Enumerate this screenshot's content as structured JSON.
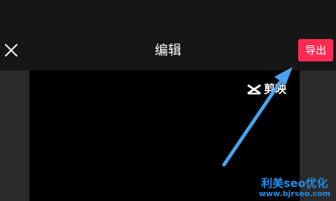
{
  "topbar": {
    "title": "编辑",
    "export_label": "导出"
  },
  "preview": {
    "watermark_text": "剪映"
  },
  "overlay": {
    "seo_watermark_line1": "利美seo优化",
    "seo_watermark_line2": "www.bjrseo.com"
  },
  "colors": {
    "export_button": "#fe2c55",
    "annotation_arrow": "#4aa3f0",
    "seo_watermark": "#1f8fe8"
  },
  "icons": {
    "close": "close-icon",
    "watermark_logo": "capcut-logo-icon",
    "annotation": "arrow-annotation-icon"
  }
}
